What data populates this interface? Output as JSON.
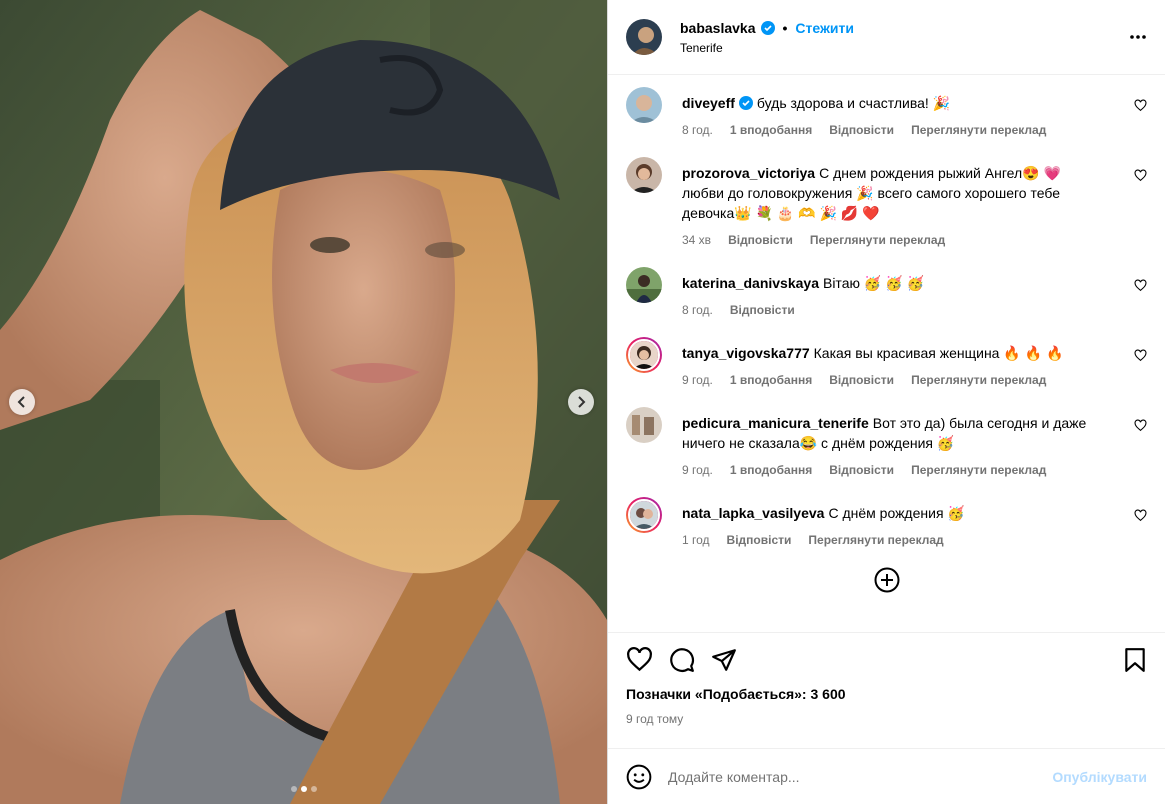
{
  "post": {
    "username": "babaslavka",
    "follow_label": "Стежити",
    "separator": "•",
    "location": "Tenerife",
    "likes_text": "Позначки «Подобається»: 3 600",
    "time_ago": "9 год тому"
  },
  "comments": [
    {
      "user": "diveyeff",
      "verified": true,
      "text": "будь здорова и счастлива! 🎉",
      "time": "8 год.",
      "likes": "1 вподобання",
      "reply": "Відповісти",
      "translate": "Переглянути переклад"
    },
    {
      "user": "prozorova_victoriya",
      "verified": false,
      "text": "С днем рождения рыжий Ангел😍 💗 любви до головокружения 🎉 всего самого хорошего тебе девочка👑 💐 🎂 🫶 🎉 💋 ❤️",
      "time": "34 хв",
      "likes": "",
      "reply": "Відповісти",
      "translate": "Переглянути переклад"
    },
    {
      "user": "katerina_danivskaya",
      "verified": false,
      "text": "Вітаю 🥳 🥳 🥳",
      "time": "8 год.",
      "likes": "",
      "reply": "Відповісти",
      "translate": ""
    },
    {
      "user": "tanya_vigovska777",
      "verified": false,
      "text": "Какая вы красивая женщина 🔥 🔥 🔥",
      "time": "9 год.",
      "likes": "1 вподобання",
      "reply": "Відповісти",
      "translate": "Переглянути переклад"
    },
    {
      "user": "pedicura_manicura_tenerife",
      "verified": false,
      "text": "Вот это да) была сегодня и даже ничего не сказала😂 с днём рождения 🥳",
      "time": "9 год.",
      "likes": "1 вподобання",
      "reply": "Відповісти",
      "translate": "Переглянути переклад"
    },
    {
      "user": "nata_lapka_vasilyeva",
      "verified": false,
      "text": "С днём рождения 🥳",
      "time": "1 год",
      "likes": "",
      "reply": "Відповісти",
      "translate": "Переглянути переклад"
    }
  ],
  "add_comment": {
    "placeholder": "Додайте коментар...",
    "post_label": "Опублікувати"
  },
  "colors": {
    "accent": "#0095f6",
    "muted": "#737373",
    "post_disabled": "#b3dbff"
  },
  "icons": [
    "verified-badge-icon",
    "more-icon",
    "heart-icon",
    "comment-icon",
    "share-icon",
    "bookmark-icon",
    "emoji-icon",
    "add-circle-icon",
    "chevron-left-icon",
    "chevron-right-icon"
  ]
}
